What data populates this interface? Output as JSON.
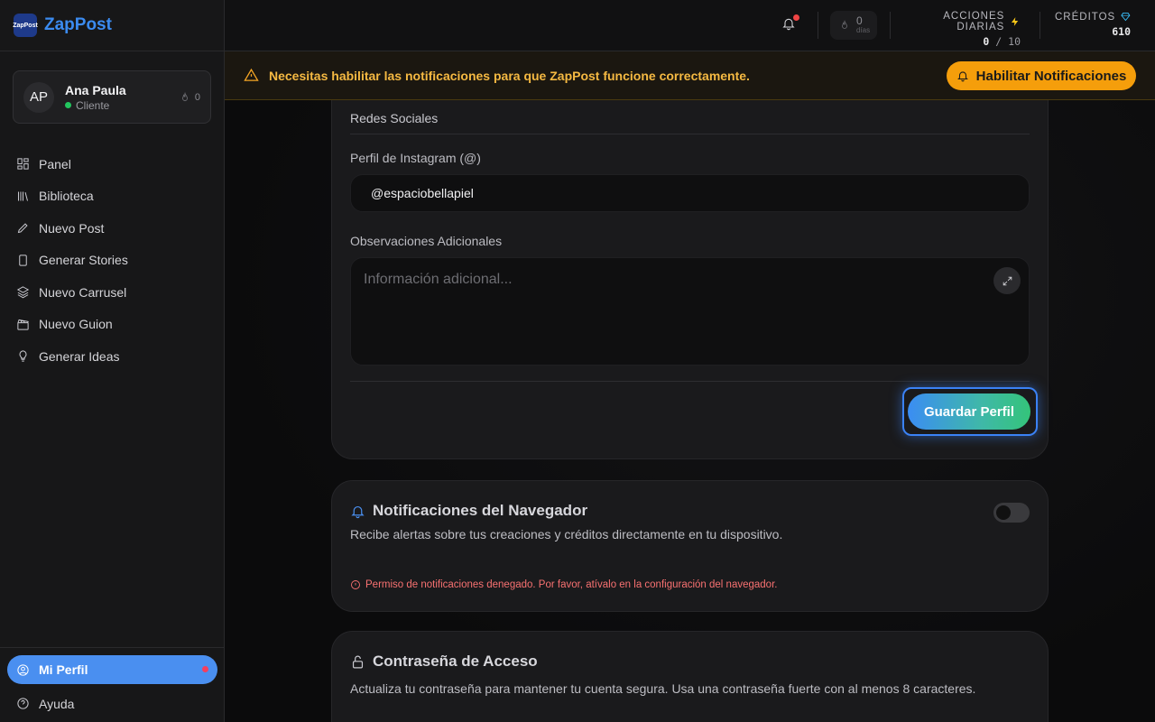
{
  "brand": {
    "name": "ZapPost",
    "logo_text": "ZapPost"
  },
  "user": {
    "initials": "AP",
    "name": "Ana Paula",
    "role": "Cliente",
    "streak": "0"
  },
  "nav": {
    "items": [
      {
        "label": "Panel",
        "icon": "grid-icon"
      },
      {
        "label": "Biblioteca",
        "icon": "library-icon"
      },
      {
        "label": "Nuevo Post",
        "icon": "pencil-icon"
      },
      {
        "label": "Generar Stories",
        "icon": "phone-icon"
      },
      {
        "label": "Nuevo Carrusel",
        "icon": "layers-icon"
      },
      {
        "label": "Nuevo Guion",
        "icon": "clapperboard-icon"
      },
      {
        "label": "Generar Ideas",
        "icon": "lightbulb-icon"
      }
    ],
    "profile": "Mi Perfil",
    "help": "Ayuda"
  },
  "topbar": {
    "streak_value": "0",
    "streak_unit": "días",
    "daily_actions_label": "ACCIONES DIARIAS",
    "daily_actions_used": "0",
    "daily_actions_sep": "/",
    "daily_actions_max": "10",
    "credits_label": "CRÉDITOS",
    "credits_value": "610"
  },
  "banner": {
    "message": "Necesitas habilitar las notificaciones para que ZapPost funcione correctamente.",
    "button": "Habilitar Notificaciones"
  },
  "profile_form": {
    "section": "Redes Sociales",
    "instagram_label": "Perfil de Instagram (@)",
    "instagram_value": "@espaciobellapiel",
    "notes_label": "Observaciones Adicionales",
    "notes_placeholder": "Información adicional...",
    "save_button": "Guardar Perfil"
  },
  "notifications_card": {
    "title": "Notificaciones del Navegador",
    "description": "Recibe alertas sobre tus creaciones y créditos directamente en tu dispositivo.",
    "toggle_on": false,
    "error": "Permiso de notificaciones denegado. Por favor, atívalo en la configuración del navegador."
  },
  "password_card": {
    "title": "Contraseña de Acceso",
    "description": "Actualiza tu contraseña para mantener tu cuenta segura. Usa una contraseña fuerte con al menos 8 caracteres."
  },
  "colors": {
    "accent": "#4a8ff0",
    "warning": "#f59e0b",
    "error": "#f87171",
    "success": "#22c55e"
  }
}
